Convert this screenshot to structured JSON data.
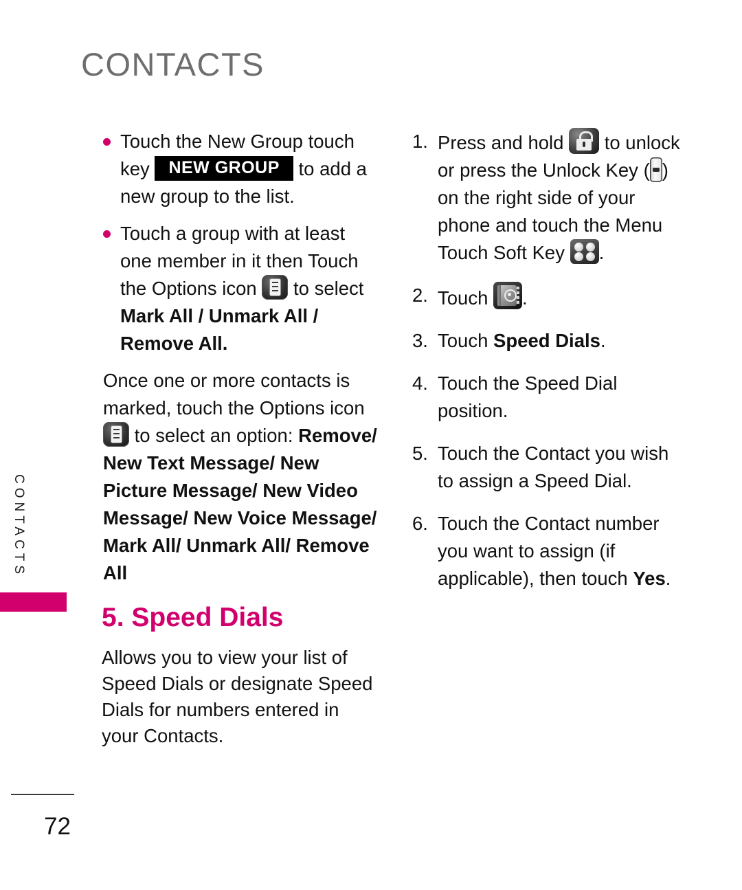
{
  "header": {
    "title": "CONTACTS"
  },
  "side_tab": {
    "label": "CONTACTS",
    "accent_color": "#d1006c"
  },
  "footer": {
    "page_number": "72"
  },
  "colors": {
    "accent_magenta": "#d1006c",
    "header_gray": "#6e6e6e",
    "body_black": "#111111"
  },
  "left_column": {
    "bullets": [
      {
        "text_before_key": "Touch the New Group touch key",
        "key_label": "NEW GROUP",
        "text_after_key": "to add a new group to the list."
      },
      {
        "text_before_icon": "Touch a group with at least one member in it then Touch the Options icon",
        "icon": "options-icon",
        "text_after_icon_normal": "to select ",
        "text_after_icon_bold": "Mark All / Unmark All / Remove All."
      }
    ],
    "paragraph": {
      "text_before_icon": "Once one or more contacts is marked, touch the Options icon",
      "icon": "options-icon",
      "text_after_icon": "to select an option:",
      "options_bold": "Remove/ New Text Message/ New Picture Message/ New Video Message/ New Voice Message/ Mark All/ Unmark All/ Remove All"
    }
  },
  "section": {
    "heading": "5. Speed Dials",
    "body": "Allows you to view your list of Speed Dials or designate Speed Dials for numbers entered in your Contacts."
  },
  "right_column": {
    "steps": [
      {
        "number": "1.",
        "part1": "Press and hold",
        "icon1": "lock-icon",
        "part2": "to unlock or press the Unlock Key (",
        "icon2": "side-unlock-key-icon",
        "part3": ") on the right side of your phone and touch the Menu Touch Soft Key",
        "icon3": "menu-soft-key-icon",
        "part4": "."
      },
      {
        "number": "2.",
        "part1": "Touch",
        "icon1": "contacts-book-icon",
        "part2": "."
      },
      {
        "number": "3.",
        "part1": "Touch ",
        "bold": "Speed Dials",
        "part2": "."
      },
      {
        "number": "4.",
        "part1": "Touch the Speed Dial position."
      },
      {
        "number": "5.",
        "part1": "Touch the Contact you wish to assign a Speed Dial."
      },
      {
        "number": "6.",
        "part1": "Touch the Contact number you want to assign (if applicable), then touch ",
        "bold": "Yes",
        "part2": "."
      }
    ]
  }
}
